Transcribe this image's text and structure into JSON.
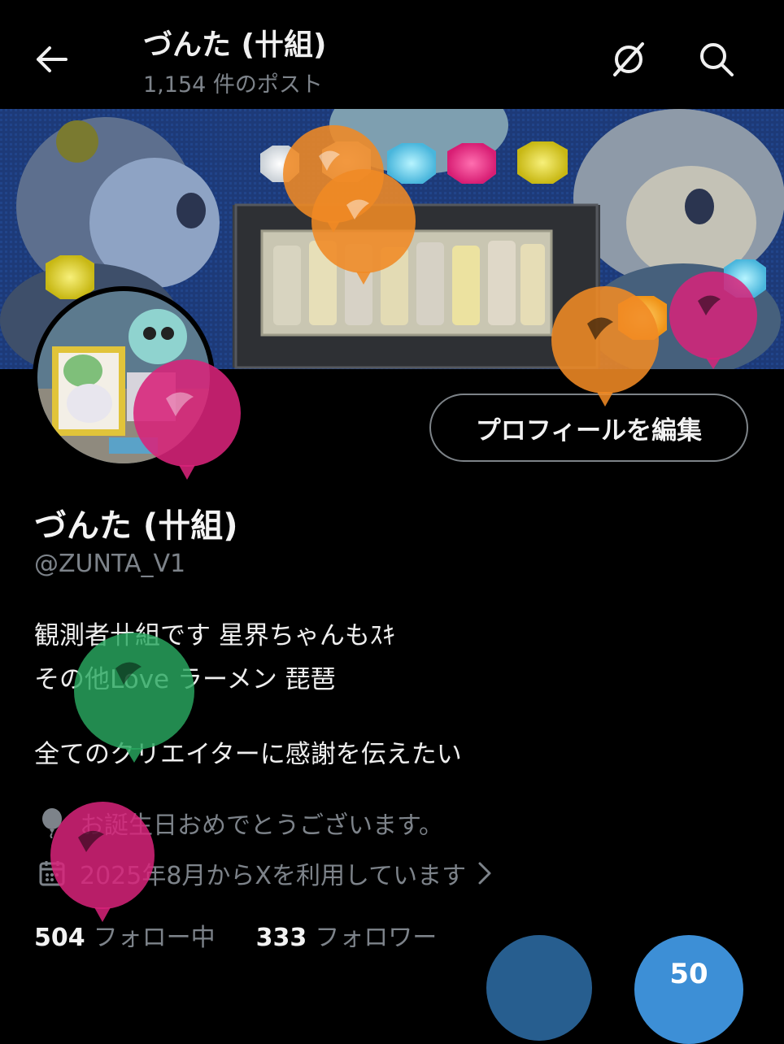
{
  "header": {
    "title": "づんた (卄組)",
    "post_count": "1,154 件のポスト"
  },
  "profile": {
    "edit_button": "プロフィールを編集",
    "display_name": "づんた (卄組)",
    "handle": "@ZUNTA_V1",
    "bio": [
      "観測者卄組です 星界ちゃんもｽｷ",
      "その他Love ラーメン 琵琶",
      "",
      "全てのクリエイターに感謝を伝えたい"
    ],
    "birthday": "お誕生日おめでとうございます。",
    "joined": "2025年8月からXを利用しています"
  },
  "stats": {
    "following_count": "504",
    "following_label": "フォロー中",
    "followers_count": "333",
    "followers_label": "フォロワー"
  },
  "fab": {
    "label": "50"
  },
  "icons": {
    "back": "back-arrow-icon",
    "grok": "grok-icon",
    "search": "search-icon",
    "balloon": "balloon-icon",
    "calendar": "calendar-icon",
    "chevron": "chevron-right-icon"
  },
  "colors": {
    "background": "#000000",
    "text_primary": "#e7e9ea",
    "text_secondary": "#7d838a",
    "balloon_orange": "#f08a24",
    "balloon_pink": "#d8237a",
    "balloon_green": "#2aa860",
    "balloon_blue": "#3b82c4"
  }
}
